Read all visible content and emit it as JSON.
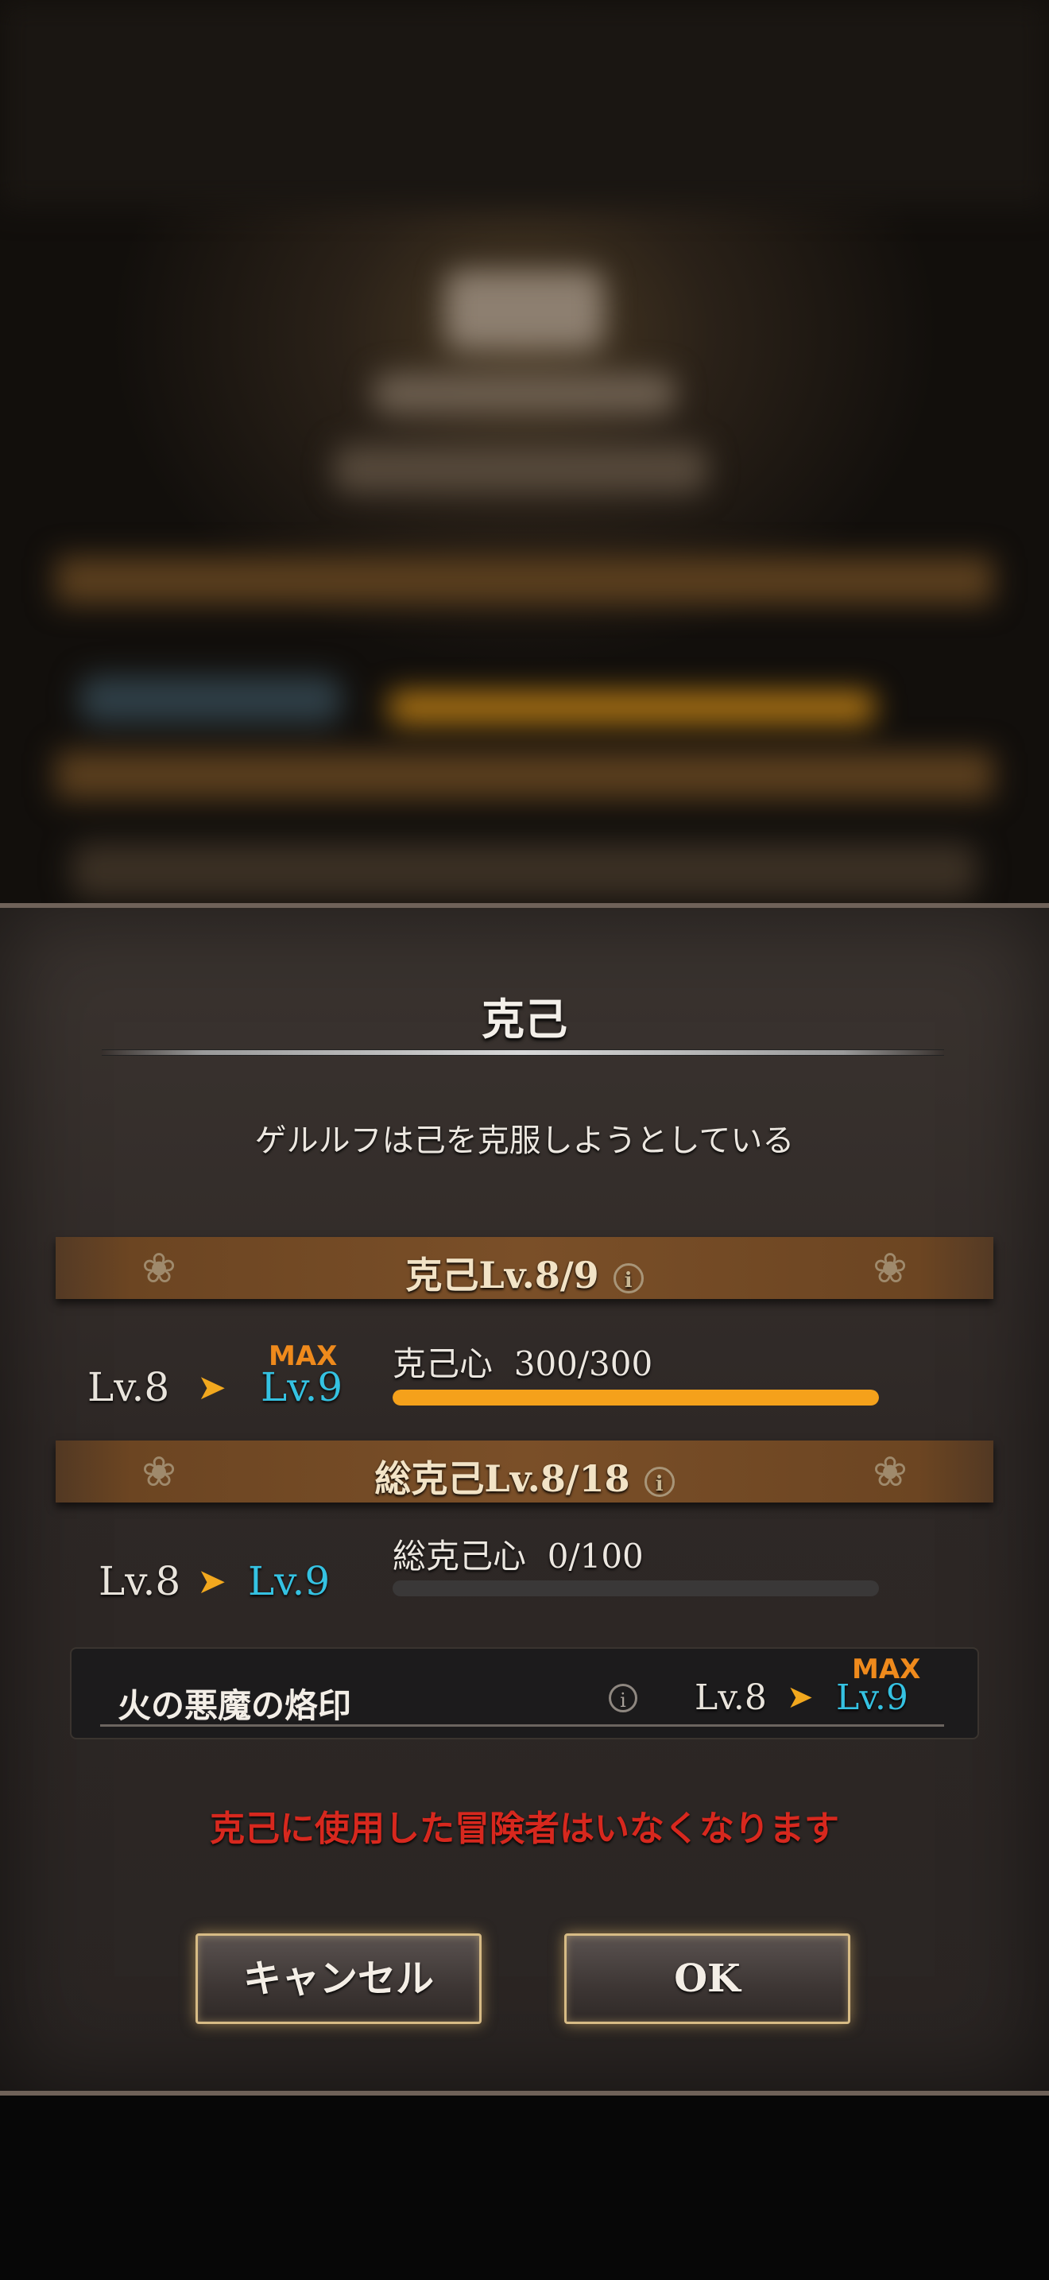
{
  "dialog": {
    "title": "克己",
    "subtitle": "ゲルルフは己を克服しようとしている",
    "section1": {
      "label": "克己Lv.8/9",
      "info_icon": "i",
      "from_level": "Lv.8",
      "to_level": "Lv.9",
      "max_badge": "MAX",
      "gauge_label": "克己心",
      "gauge_value": "300/300",
      "gauge_fraction": 1.0
    },
    "section2": {
      "label": "総克己Lv.8/18",
      "info_icon": "i",
      "from_level": "Lv.8",
      "to_level": "Lv.9",
      "gauge_label": "総克己心",
      "gauge_value": "0/100",
      "gauge_fraction": 0.0
    },
    "brand": {
      "name": "火の悪魔の烙印",
      "info_icon": "i",
      "from_level": "Lv.8",
      "to_level": "Lv.9",
      "max_badge": "MAX"
    },
    "warning": "克己に使用した冒険者はいなくなります",
    "buttons": {
      "cancel": "キャンセル",
      "ok": "OK"
    },
    "arrow_glyph": "➤",
    "colors": {
      "accent_gold": "#f5a11b",
      "level_new": "#35c2e2",
      "max_badge": "#ef8a1c",
      "warning": "#d7281e"
    }
  }
}
